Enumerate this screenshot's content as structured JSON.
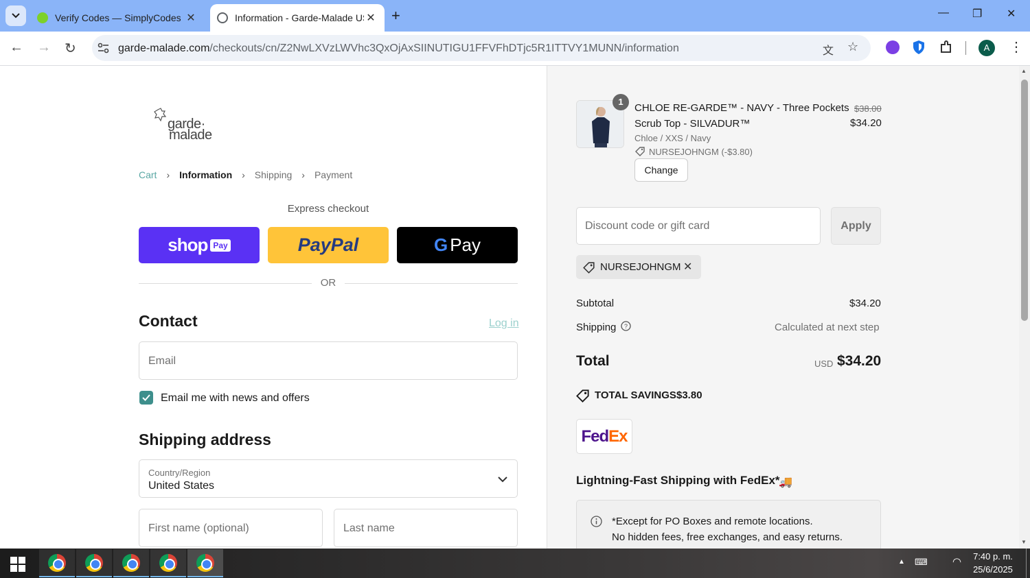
{
  "browser": {
    "tabs": [
      {
        "title": "Verify Codes — SimplyCodes",
        "active": false
      },
      {
        "title": "Information - Garde-Malade US",
        "active": true
      }
    ],
    "url_host": "garde-malade.com",
    "url_path": "/checkouts/cn/Z2NwLXVzLWVhc3QxOjAxSIINUTIGU1FFVFhDTjc5R1ITTVY1MUNN/information",
    "profile_initial": "A"
  },
  "store": {
    "logo_line1": "garde·",
    "logo_line2": "malade"
  },
  "breadcrumb": {
    "cart": "Cart",
    "information": "Information",
    "shipping": "Shipping",
    "payment": "Payment"
  },
  "express": {
    "heading": "Express checkout",
    "shop_label": "shop",
    "shop_pay_badge": "Pay",
    "paypal_label": "PayPal",
    "gpay_g": "G",
    "gpay_label": "Pay",
    "or": "OR"
  },
  "contact": {
    "heading": "Contact",
    "login": "Log in",
    "email_placeholder": "Email",
    "newsletter_label": "Email me with news and offers",
    "newsletter_checked": true
  },
  "shipping_address": {
    "heading": "Shipping address",
    "country_label": "Country/Region",
    "country_value": "United States",
    "first_name_placeholder": "First name (optional)",
    "last_name_placeholder": "Last name"
  },
  "order": {
    "item": {
      "quantity": "1",
      "name_line1": "CHLOE RE-GARDE™ - NAVY - Three Pockets",
      "name_line2": "Scrub Top - SILVADUR™",
      "variant": "Chloe / XXS / Navy",
      "discount": "NURSEJOHNGM (-$3.80)",
      "original_price": "$38.00",
      "price": "$34.20",
      "change_button": "Change"
    },
    "discount_placeholder": "Discount code or gift card",
    "apply_button": "Apply",
    "applied_code": "NURSEJOHNGM",
    "subtotal_label": "Subtotal",
    "subtotal_value": "$34.20",
    "shipping_label": "Shipping",
    "shipping_value": "Calculated at next step",
    "total_label": "Total",
    "total_currency": "USD",
    "total_value": "$34.20",
    "savings_label": "TOTAL SAVINGS",
    "savings_value": "$3.80",
    "fedex_logo": "FedEx",
    "fedex_heading": "Lightning-Fast Shipping with FedEx*",
    "note_line1": "*Except for PO Boxes and remote locations.",
    "note_line2": "No hidden fees, free exchanges, and easy returns."
  },
  "taskbar": {
    "time": "7:40 p. m.",
    "date": "25/6/2025"
  },
  "colors": {
    "shop_purple": "#5a31f4",
    "paypal_yellow": "#ffc439",
    "accent_teal": "#3e8f8c",
    "tab_bar": "#8ab4f8"
  }
}
